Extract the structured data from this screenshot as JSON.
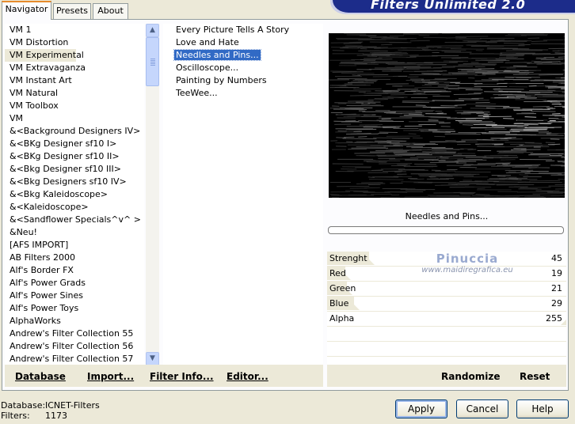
{
  "app": {
    "brand_title": "Filters Unlimited 2.0"
  },
  "tabs": [
    {
      "label": "Navigator",
      "active": true
    },
    {
      "label": "Presets",
      "active": false
    },
    {
      "label": "About",
      "active": false
    }
  ],
  "categories": {
    "selected_index": 2,
    "items": [
      "VM 1",
      "VM Distortion",
      "VM Experimental",
      "VM Extravaganza",
      "VM Instant Art",
      "VM Natural",
      "VM Toolbox",
      "VM",
      "&<Background Designers IV>",
      "&<BKg Designer sf10 I>",
      "&<BKg Designer sf10 II>",
      "&<Bkg Designer sf10 III>",
      "&<Bkg Designers sf10 IV>",
      "&<Bkg Kaleidoscope>",
      "&<Kaleidoscope>",
      "&<Sandflower Specials^v^ >",
      "&Neu!",
      "[AFS IMPORT]",
      "AB Filters 2000",
      "Alf's Border FX",
      "Alf's Power Grads",
      "Alf's Power Sines",
      "Alf's Power Toys",
      "AlphaWorks",
      "Andrew's Filter Collection 55",
      "Andrew's Filter Collection 56",
      "Andrew's Filter Collection 57"
    ]
  },
  "scrollbar": {
    "up_icon": "scroll-up-arrow",
    "down_icon": "scroll-down-arrow",
    "up_glyph": "▲",
    "down_glyph": "▼"
  },
  "filters": {
    "selected_index": 2,
    "items": [
      "Every Picture Tells A Story",
      "Love and Hate",
      "Needles and Pins...",
      "Oscilloscope...",
      "Painting by Numbers",
      "TeeWee..."
    ]
  },
  "preview": {
    "filter_name": "Needles and Pins..."
  },
  "parameters": [
    {
      "label": "Strenght",
      "value": "45",
      "level": 45
    },
    {
      "label": "Red",
      "value": "19",
      "level": 19
    },
    {
      "label": "Green",
      "value": "21",
      "level": 21
    },
    {
      "label": "Blue",
      "value": "29",
      "level": 29
    },
    {
      "label": "Alpha",
      "value": "255",
      "level": 255
    }
  ],
  "parameter_max": 255,
  "watermark": {
    "name": "Pinuccia",
    "site": "www.maidiregrafica.eu"
  },
  "actions_left": {
    "database": "Database",
    "import": "Import...",
    "filter_info": "Filter Info...",
    "editor": "Editor..."
  },
  "actions_right": {
    "randomize": "Randomize",
    "reset": "Reset"
  },
  "footer": {
    "database_label": "Database:",
    "database_value": "ICNET-Filters",
    "filters_label": "Filters:",
    "filters_value": "1173"
  },
  "buttons": {
    "apply": "Apply",
    "cancel": "Cancel",
    "help": "Help"
  },
  "colors": {
    "dialog_bg": "#ece9d8",
    "selection_blue": "#316ac5",
    "brand_blue": "#1c2c8a",
    "tab_accent": "#e68b2c"
  }
}
